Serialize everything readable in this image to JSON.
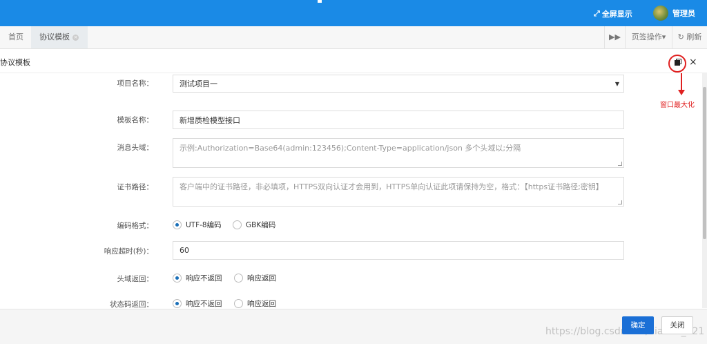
{
  "topbar": {
    "fullscreen_icon": "expand-icon",
    "fullscreen_label": "全屏显示",
    "user_name": "管理员"
  },
  "tabs": {
    "home": "首页",
    "active": "协议模板",
    "close_glyph": "×",
    "forward_glyph": "▶▶",
    "page_ops": "页签操作▾",
    "refresh": "↻ 刷新"
  },
  "modal": {
    "title": "协议模板",
    "close_glyph": "×",
    "annotation": "窗口最大化"
  },
  "form": {
    "project_label": "项目名称：",
    "project_value": "测试项目一",
    "template_label": "模板名称：",
    "template_value": "新增质检模型接口",
    "header_label": "消息头域：",
    "header_placeholder": "示例:Authorization=Base64(admin:123456);Content-Type=application/json    多个头域以;分隔",
    "cert_label": "证书路径：",
    "cert_placeholder": "客户端中的证书路径，非必填项，HTTPS双向认证才会用到，HTTPS单向认证此项请保持为空，格式：【https证书路径;密钥】",
    "encoding_label": "编码格式：",
    "encoding_options": [
      "UTF-8编码",
      "GBK编码"
    ],
    "timeout_label": "响应超时(秒)：",
    "timeout_value": "60",
    "header_return_label": "头域返回：",
    "header_return_options": [
      "响应不返回",
      "响应返回"
    ],
    "status_return_label": "状态码返回：",
    "status_return_options": [
      "响应不返回",
      "响应返回"
    ]
  },
  "footer": {
    "ok": "确定",
    "close": "关闭",
    "watermark": "https://blog.csdn.net/xiaomi_121"
  }
}
